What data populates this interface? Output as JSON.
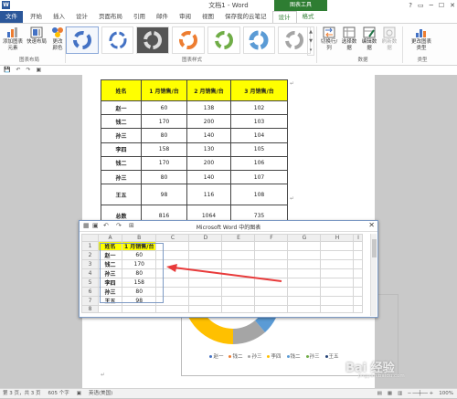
{
  "window": {
    "title": "文档1 - Word",
    "context_title": "图表工具",
    "controls": [
      "?",
      "▭",
      "─",
      "☐",
      "✕"
    ]
  },
  "tabs": [
    "文件",
    "开始",
    "插入",
    "设计",
    "页面布局",
    "引用",
    "邮件",
    "审阅",
    "视图",
    "保存我的云笔记",
    "设计",
    "格式"
  ],
  "ribbon": {
    "add_element": "添加图表元素",
    "quick_layout": "快速布局",
    "change_colors": "更改颜色",
    "switch_rowcol": "切换行/列",
    "select_data": "选择数据",
    "edit_data": "编辑数据",
    "refresh_data": "刷新数据",
    "change_type": "更改图表类型",
    "group_layout": "图表布局",
    "group_styles": "图表样式",
    "group_data": "数据",
    "group_type": "类型"
  },
  "qat": [
    "💾",
    "↶",
    "↷",
    "▣"
  ],
  "doc_table": {
    "headers": [
      "姓名",
      "1 月销售/台",
      "2 月销售/台",
      "3 月销售/台"
    ],
    "rows": [
      [
        "赵一",
        "60",
        "138",
        "102"
      ],
      [
        "钱二",
        "170",
        "200",
        "103"
      ],
      [
        "孙三",
        "80",
        "140",
        "104"
      ],
      [
        "李四",
        "158",
        "130",
        "105"
      ],
      [
        "钱二",
        "170",
        "200",
        "106"
      ],
      [
        "孙三",
        "80",
        "140",
        "107"
      ],
      [
        "王五",
        "98",
        "116",
        "108"
      ],
      [
        "总数",
        "816",
        "1064",
        "735"
      ]
    ]
  },
  "chart_legend": [
    "赵一",
    "钱二",
    "孙三",
    "李四",
    "钱二",
    "孙三",
    "王五"
  ],
  "excel": {
    "title": "Microsoft Word 中的图表",
    "col_headers": [
      "",
      "A",
      "B",
      "C",
      "D",
      "E",
      "F",
      "G",
      "H",
      "I"
    ],
    "rows": [
      {
        "n": "1",
        "a": "姓名",
        "b": "1 月销售/台"
      },
      {
        "n": "2",
        "a": "赵一",
        "b": "60"
      },
      {
        "n": "3",
        "a": "钱二",
        "b": "170"
      },
      {
        "n": "4",
        "a": "孙三",
        "b": "80"
      },
      {
        "n": "5",
        "a": "李四",
        "b": "158"
      },
      {
        "n": "6",
        "a": "孙三",
        "b": "80"
      },
      {
        "n": "7",
        "a": "王五",
        "b": "98"
      },
      {
        "n": "8",
        "a": "",
        "b": ""
      }
    ]
  },
  "status": {
    "page": "第 3 页，共 3 页",
    "words": "605 个字",
    "lang": "英语(美国)",
    "zoom": "100%"
  },
  "watermark": {
    "main": "Bai 经验",
    "sub": "jingyan.baidu.com"
  },
  "colors": {
    "word_blue": "#2b579a",
    "chart_green": "#2e7d32",
    "header_yellow": "#ffff00",
    "arrow_red": "#e83a3a"
  }
}
